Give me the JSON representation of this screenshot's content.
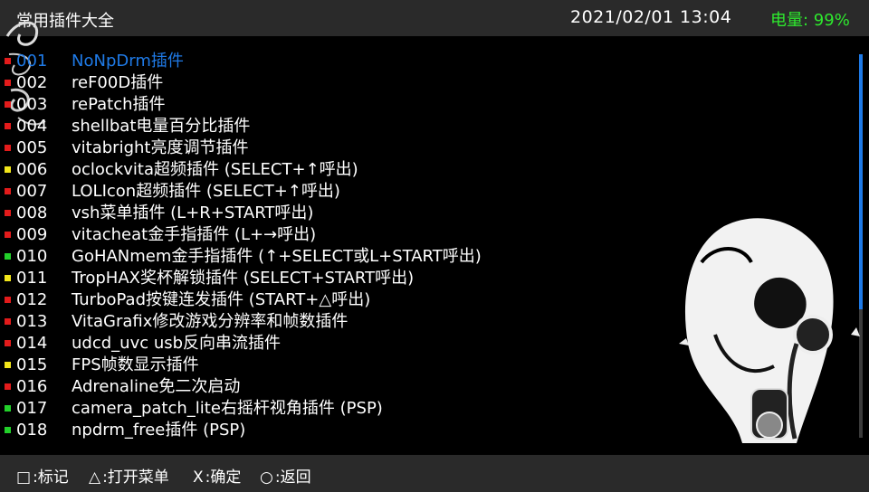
{
  "header": {
    "title": "常用插件大全",
    "datetime": "2021/02/01   13:04",
    "battery": "电量: 99%"
  },
  "colors": {
    "red": "#e31b1b",
    "yellow": "#f2e61a",
    "green": "#22d02a",
    "accent": "#1f7ae6"
  },
  "items": [
    {
      "num": "001",
      "label": "NoNpDrm插件",
      "status": "red",
      "selected": true
    },
    {
      "num": "002",
      "label": "reF00D插件",
      "status": "red"
    },
    {
      "num": "003",
      "label": "rePatch插件",
      "status": "red"
    },
    {
      "num": "004",
      "label": "shellbat电量百分比插件",
      "status": "red"
    },
    {
      "num": "005",
      "label": "vitabright亮度调节插件",
      "status": "red"
    },
    {
      "num": "006",
      "label": "oclockvita超频插件 (SELECT+↑呼出)",
      "status": "yellow"
    },
    {
      "num": "007",
      "label": "LOLIcon超频插件 (SELECT+↑呼出)",
      "status": "red"
    },
    {
      "num": "008",
      "label": "vsh菜单插件 (L+R+START呼出)",
      "status": "red"
    },
    {
      "num": "009",
      "label": "vitacheat金手指插件 (L+→呼出)",
      "status": "red"
    },
    {
      "num": "010",
      "label": "GoHANmem金手指插件 (↑+SELECT或L+START呼出)",
      "status": "green"
    },
    {
      "num": "011",
      "label": "TropHAX奖杯解锁插件 (SELECT+START呼出)",
      "status": "yellow"
    },
    {
      "num": "012",
      "label": "TurboPad按键连发插件 (START+△呼出)",
      "status": "red"
    },
    {
      "num": "013",
      "label": "VitaGrafix修改游戏分辨率和帧数插件",
      "status": "red"
    },
    {
      "num": "014",
      "label": "udcd_uvc usb反向串流插件",
      "status": "red"
    },
    {
      "num": "015",
      "label": "FPS帧数显示插件",
      "status": "yellow"
    },
    {
      "num": "016",
      "label": "Adrenaline免二次启动",
      "status": "red"
    },
    {
      "num": "017",
      "label": "camera_patch_lite右摇杆视角插件 (PSP)",
      "status": "green"
    },
    {
      "num": "018",
      "label": "npdrm_free插件 (PSP)",
      "status": "green"
    }
  ],
  "footer": {
    "hints": [
      {
        "glyph": "□",
        "text": ":标记",
        "icon": "square-button-icon"
      },
      {
        "glyph": "△",
        "text": ":打开菜单",
        "icon": "triangle-button-icon"
      },
      {
        "glyph": "X",
        "text": ":确定",
        "icon": "cross-button-icon"
      },
      {
        "glyph": "○",
        "text": ":返回",
        "icon": "circle-button-icon"
      }
    ]
  }
}
